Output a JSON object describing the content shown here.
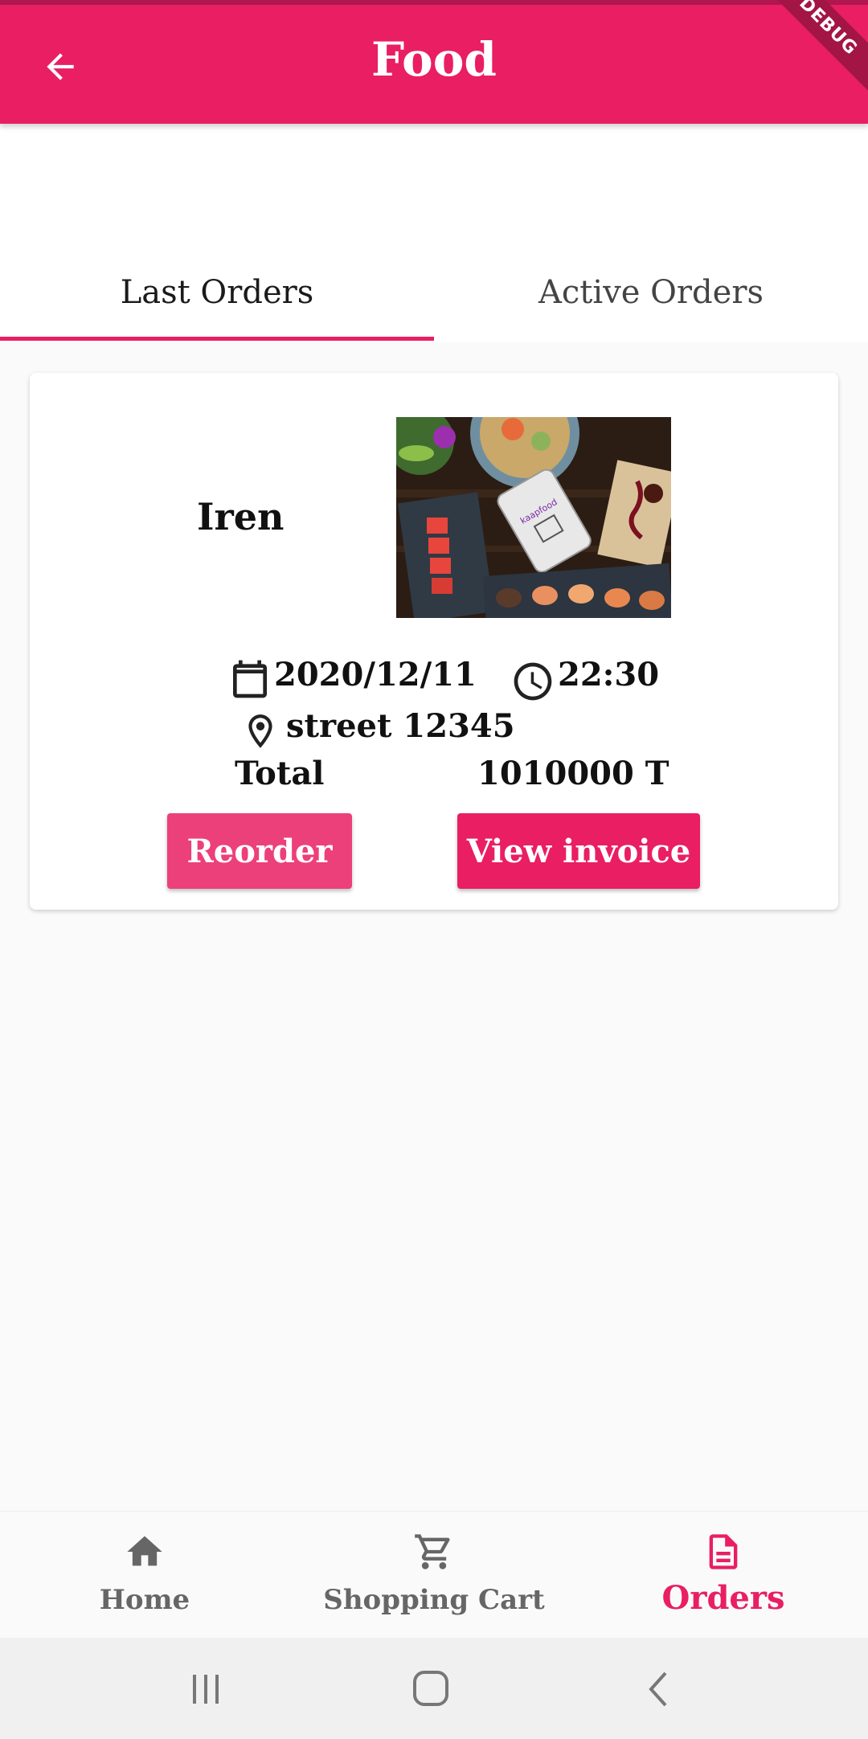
{
  "appbar": {
    "title": "Food",
    "debug_banner": "DEBUG",
    "back_icon": "arrow-back-icon"
  },
  "tabs": [
    {
      "label": "Last Orders",
      "selected": true
    },
    {
      "label": "Active Orders",
      "selected": false
    }
  ],
  "order": {
    "restaurant": "Iren",
    "image_icon": "food-photo",
    "image_overlay_text": "kaapfood",
    "date": "2020/12/11",
    "time": "22:30",
    "address": "street 12345",
    "total_label": "Total",
    "total_value": "1010000 T",
    "reorder_label": "Reorder",
    "invoice_label": "View invoice"
  },
  "bottom_nav": [
    {
      "label": "Home",
      "icon": "home-icon",
      "active": false
    },
    {
      "label": "Shopping Cart",
      "icon": "cart-icon",
      "active": false
    },
    {
      "label": "Orders",
      "icon": "document-icon",
      "active": true
    }
  ],
  "colors": {
    "primary": "#e91e63",
    "primary_light": "#ec407a",
    "inactive": "#666666"
  }
}
